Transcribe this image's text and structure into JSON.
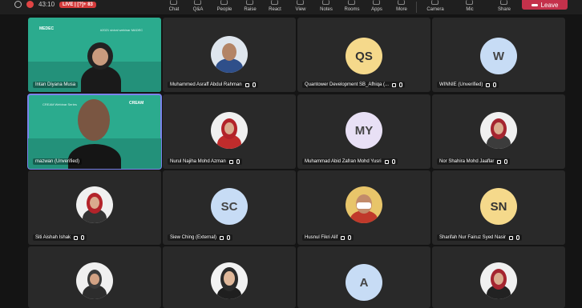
{
  "toolbar": {
    "timer": "43:10",
    "live": "LIVE | [?]+ 83",
    "items": [
      "Chat",
      "Q&A",
      "People",
      "Raise",
      "React",
      "View",
      "Notes",
      "Rooms",
      "Apps",
      "More",
      "Camera",
      "Mic",
      "Share"
    ],
    "leave": "Leave"
  },
  "slides": {
    "slide1_brand": "MEDEC",
    "slide1_sub": "#2021 siviral webinar MADEC",
    "slide2_brand": "CREAM",
    "slide2_sub": "CREAM Webinar Series"
  },
  "participants": [
    {
      "name": "Intan Diyana Musa"
    },
    {
      "name": "Muhammed Asraff Abdul Rahman"
    },
    {
      "name": "Quantower Development SB_Afhiqa (...",
      "initials": "QS"
    },
    {
      "name": "WINNIE (Unverified)",
      "initials": "W"
    },
    {
      "name": "mazwan (Unverified)"
    },
    {
      "name": "Nurul Najiha Mohd Azman"
    },
    {
      "name": "Muhammad Abid Zafran Mohd Yusri",
      "initials": "MY"
    },
    {
      "name": "Nor Shahira Mohd Jaaflar"
    },
    {
      "name": "Siti Aishah Ishak"
    },
    {
      "name": "Siew Ching (External)",
      "initials": "SC"
    },
    {
      "name": "Husnul Fikri Alif"
    },
    {
      "name": "Sharifah Nur Fairuz Syed Nasir",
      "initials": "SN"
    },
    {
      "name": ""
    },
    {
      "name": ""
    },
    {
      "name": "",
      "initials": "A"
    },
    {
      "name": ""
    }
  ]
}
